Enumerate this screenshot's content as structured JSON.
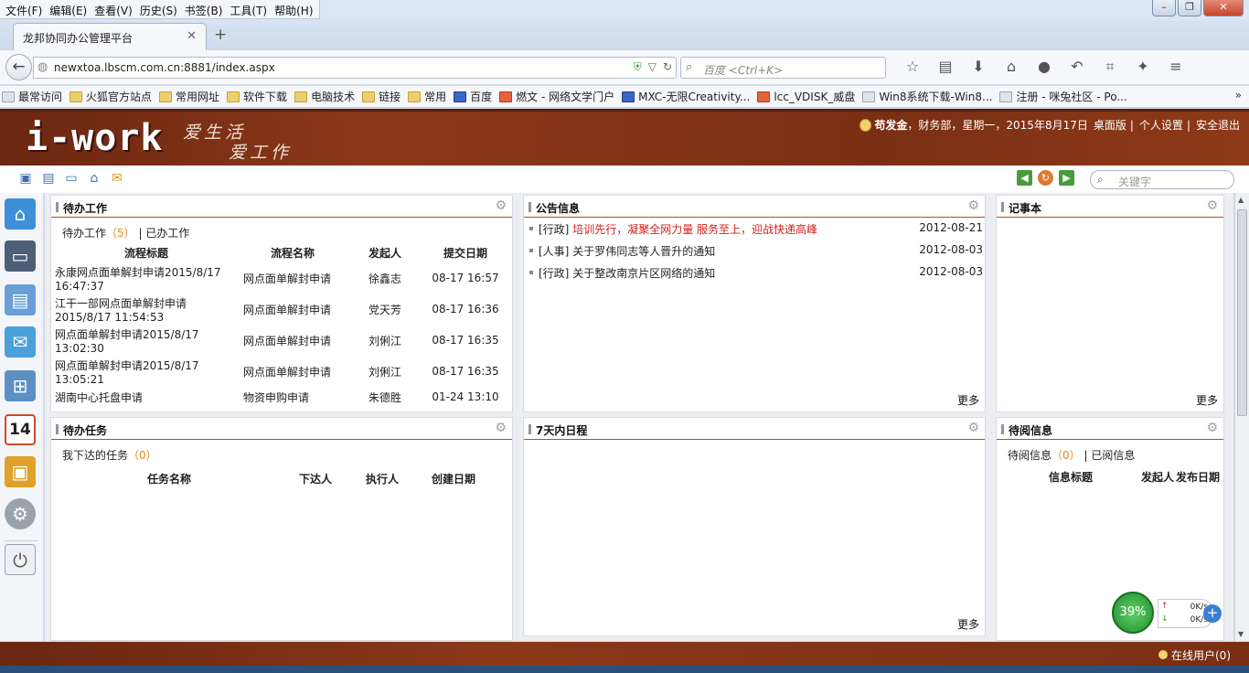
{
  "browser": {
    "menu": [
      "文件(F)",
      "编辑(E)",
      "查看(V)",
      "历史(S)",
      "书签(B)",
      "工具(T)",
      "帮助(H)"
    ],
    "tab_title": "龙邦协同办公管理平台",
    "url": "newxtoa.lbscm.com.cn:8881/index.aspx",
    "search_placeholder": "百度 <Ctrl+K>",
    "bookmarks": [
      "最常访问",
      "火狐官方站点",
      "常用网址",
      "软件下载",
      "电脑技术",
      "链接",
      "常用",
      "百度",
      "燃文 - 网络文学门户",
      "MXC-无限Creativity...",
      "lcc_VDISK_威盘",
      "Win8系统下载-Win8...",
      "注册 - 咪兔社区 - Po..."
    ]
  },
  "header": {
    "logo": "i-work",
    "slogan_line1": "爱生活",
    "slogan_line2": "爱工作",
    "user_name": "苟发金",
    "user_info": "，财务部，星期一，2015年8月17日",
    "links": [
      "桌面版",
      "个人设置",
      "安全退出"
    ]
  },
  "toolbar": {
    "keyword_placeholder": "关键字"
  },
  "panels": {
    "todo_work": {
      "title": "待办工作",
      "tab_active": "待办工作",
      "tab_count": "5",
      "tab_other": "已办工作",
      "columns": [
        "流程标题",
        "流程名称",
        "发起人",
        "提交日期"
      ],
      "rows": [
        {
          "title": "永康网点面单解封申请2015/8/17 16:47:37",
          "flow": "网点面单解封申请",
          "starter": "徐鑫志",
          "date": "08-17 16:57"
        },
        {
          "title": "江干一部网点面单解封申请2015/8/17 11:54:53",
          "flow": "网点面单解封申请",
          "starter": "党天芳",
          "date": "08-17 16:36"
        },
        {
          "title": "网点面单解封申请2015/8/17 13:02:30",
          "flow": "网点面单解封申请",
          "starter": "刘俐江",
          "date": "08-17 16:35"
        },
        {
          "title": "网点面单解封申请2015/8/17 13:05:21",
          "flow": "网点面单解封申请",
          "starter": "刘俐江",
          "date": "08-17 16:35"
        },
        {
          "title": "湖南中心托盘申请",
          "flow": "物资申购申请",
          "starter": "朱德胜",
          "date": "01-24 13:10"
        }
      ]
    },
    "notice": {
      "title": "公告信息",
      "more": "更多",
      "items": [
        {
          "cat": "[行政]",
          "title": "培训先行，凝聚全网力量 服务至上，迎战快递高峰",
          "date": "2012-08-21",
          "highlight": true
        },
        {
          "cat": "[人事]",
          "title": "关于罗伟同志等人晋升的通知",
          "date": "2012-08-03",
          "highlight": false
        },
        {
          "cat": "[行政]",
          "title": "关于整改南京片区网络的通知",
          "date": "2012-08-03",
          "highlight": false
        }
      ]
    },
    "notebook": {
      "title": "记事本",
      "more": "更多"
    },
    "todo_task": {
      "title": "待办任务",
      "tab_active": "我下达的任务",
      "tab_count": "0",
      "columns": [
        "任务名称",
        "下达人",
        "执行人",
        "创建日期"
      ]
    },
    "schedule": {
      "title": "7天内日程",
      "more": "更多"
    },
    "to_read": {
      "title": "待阅信息",
      "tab_active": "待阅信息",
      "tab_count": "0",
      "tab_other": "已阅信息",
      "columns": [
        "信息标题",
        "发起人",
        "发布日期"
      ]
    }
  },
  "footer": {
    "online": "在线用户(0)"
  },
  "speed_widget": {
    "percent": "39%",
    "up": "0K/s",
    "down": "0K/s"
  },
  "sidebar": {
    "calendar_day": "14"
  }
}
